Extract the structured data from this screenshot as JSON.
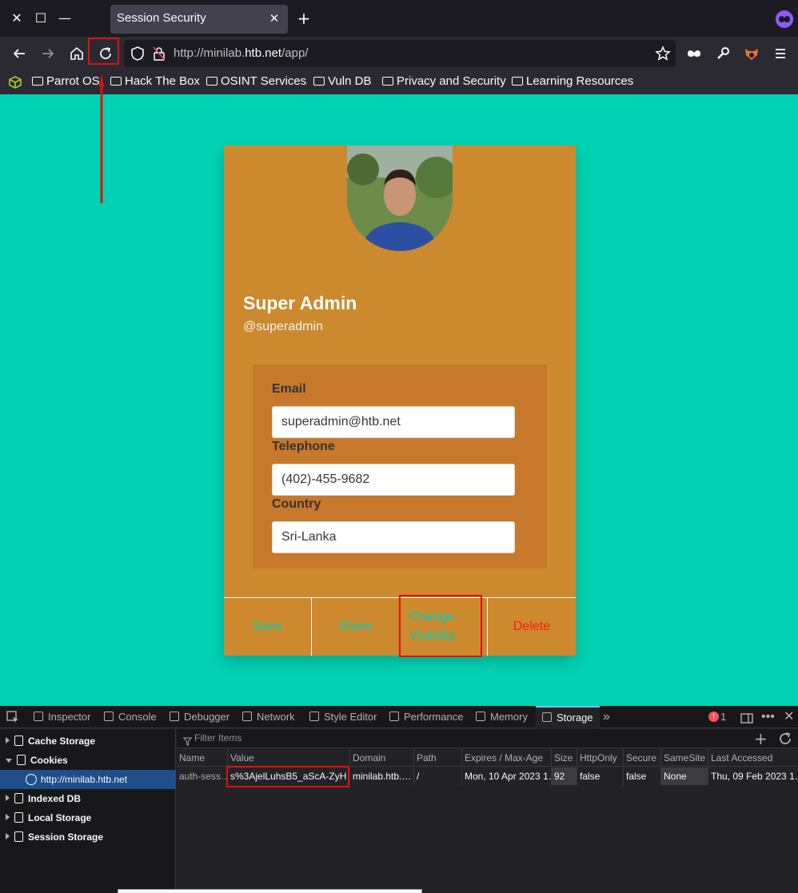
{
  "window": {
    "tab_title": "Session Security",
    "close_glyph": "✕",
    "maximize_glyph": "☐",
    "minimize_glyph": "—",
    "new_tab_glyph": "+"
  },
  "navbar": {
    "url_prefix": "http://minilab.",
    "url_host": "htb.net",
    "url_suffix": "/app/"
  },
  "bookmarks": {
    "items": [
      {
        "label": "Parrot OS"
      },
      {
        "label": "Hack The Box"
      },
      {
        "label": "OSINT Services"
      },
      {
        "label": "Vuln DB"
      },
      {
        "label": "Privacy and Security"
      },
      {
        "label": "Learning Resources"
      }
    ]
  },
  "profile": {
    "name": "Super Admin",
    "handle": "@superadmin",
    "email_label": "Email",
    "email_value": "superadmin@htb.net",
    "telephone_label": "Telephone",
    "telephone_value": "(402)-455-9682",
    "country_label": "Country",
    "country_value": "Sri-Lanka",
    "actions": {
      "save": "Save",
      "share": "Share",
      "change_visibility": "Change Visibility",
      "delete": "Delete"
    }
  },
  "devtools": {
    "tabs": [
      {
        "label": "Inspector"
      },
      {
        "label": "Console"
      },
      {
        "label": "Debugger"
      },
      {
        "label": "Network"
      },
      {
        "label": "Style Editor"
      },
      {
        "label": "Performance"
      },
      {
        "label": "Memory"
      },
      {
        "label": "Storage"
      }
    ],
    "error_count": "1",
    "sidebar": [
      {
        "label": "Cache Storage"
      },
      {
        "label": "Cookies"
      },
      {
        "label": "http://minilab.htb.net"
      },
      {
        "label": "Indexed DB"
      },
      {
        "label": "Local Storage"
      },
      {
        "label": "Session Storage"
      }
    ],
    "filter_placeholder": "Filter Items",
    "columns": [
      "Name",
      "Value",
      "Domain",
      "Path",
      "Expires / Max-Age",
      "Size",
      "HttpOnly",
      "Secure",
      "SameSite",
      "Last Accessed"
    ],
    "cookie_row": [
      "auth-sess…",
      "s%3AjelLuhsB5_aScA-ZyH…",
      "minilab.htb.…",
      "/",
      "Mon, 10 Apr 2023 1…",
      "92",
      "false",
      "false",
      "None",
      "Thu, 09 Feb 2023 1…"
    ]
  },
  "colors": {
    "page_bg": "#00d1b2",
    "card_bg": "#cc892d",
    "details_bg": "#c8782a",
    "action_text": "#00d1b2",
    "delete_text": "#ff1a1a",
    "annotation": "#e01010",
    "devtools_selected": "#204e8a"
  }
}
